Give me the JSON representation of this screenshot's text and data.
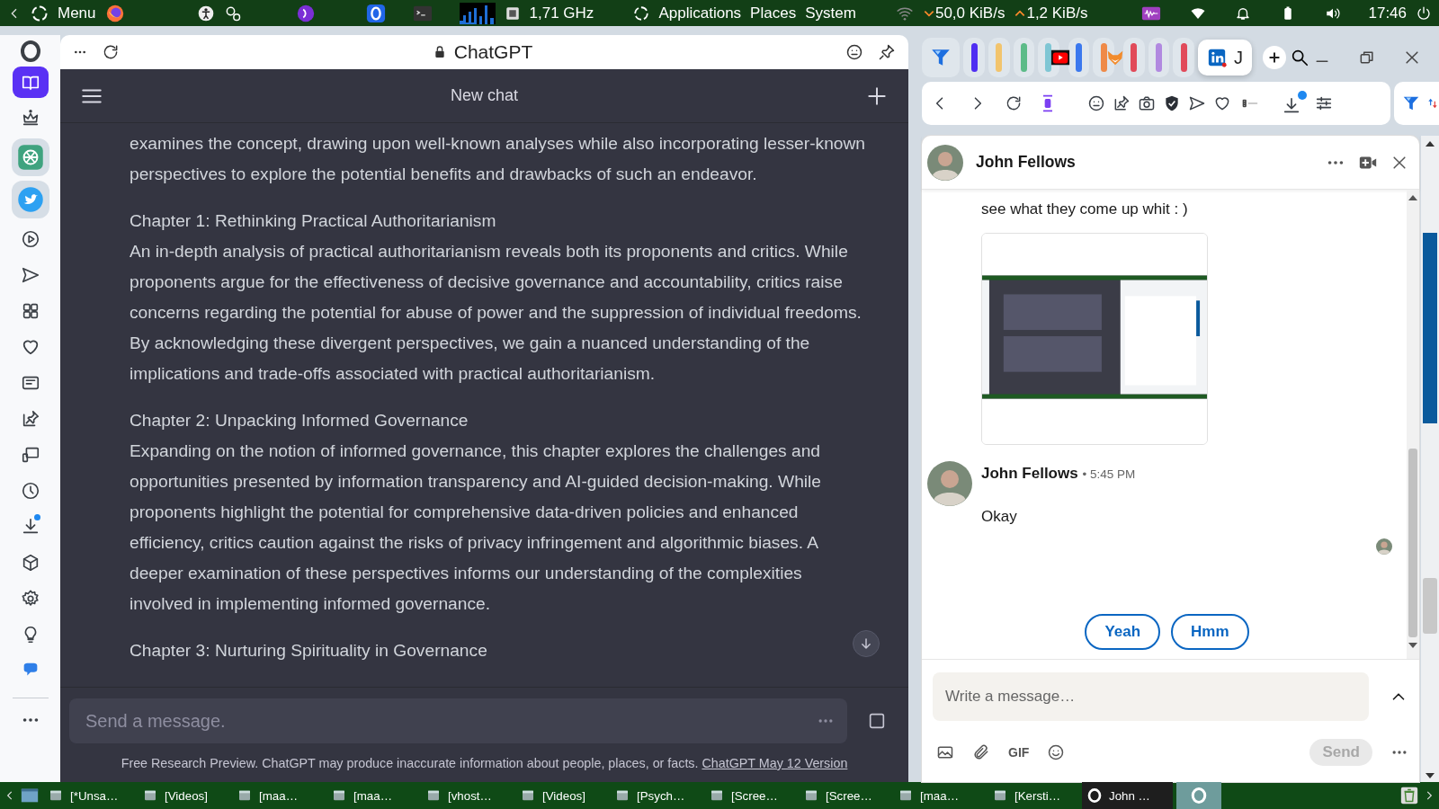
{
  "top_panel": {
    "menu_label": "Menu",
    "cpu_frequency": "1,71 GHz",
    "menus": [
      "Applications",
      "Places",
      "System"
    ],
    "download_rate": "50,0 KiB/s",
    "upload_rate": "1,2 KiB/s",
    "clock": "17:46"
  },
  "browser": {
    "sidebar_items": [
      {
        "selected": true
      },
      {
        "selected": false
      },
      {
        "selected": false
      },
      {
        "selected": false
      },
      {
        "selected": false
      },
      {
        "selected": false
      },
      {
        "selected": false
      },
      {
        "selected": false
      },
      {
        "selected": false
      },
      {
        "selected": false
      },
      {
        "selected": false
      },
      {
        "selected": false
      },
      {
        "selected": false
      },
      {
        "selected": false
      },
      {
        "selected": false
      },
      {
        "selected": false
      },
      {
        "selected": false
      }
    ],
    "address_bar": {
      "title": "ChatGPT"
    },
    "chatgpt": {
      "header_title": "New chat",
      "sections": [
        {
          "body": "examines the concept, drawing upon well-known analyses while also incorporating lesser-known perspectives to explore the potential benefits and drawbacks of such an endeavor."
        },
        {
          "heading": "Chapter 1: Rethinking Practical Authoritarianism",
          "body": "An in-depth analysis of practical authoritarianism reveals both its proponents and critics. While proponents argue for the effectiveness of decisive governance and accountability, critics raise concerns regarding the potential for abuse of power and the suppression of individual freedoms. By acknowledging these divergent perspectives, we gain a nuanced understanding of the implications and trade-offs associated with practical authoritarianism."
        },
        {
          "heading": "Chapter 2: Unpacking Informed Governance",
          "body": "Expanding on the notion of informed governance, this chapter explores the challenges and opportunities presented by information transparency and AI-guided decision-making. While proponents highlight the potential for comprehensive data-driven policies and enhanced efficiency, critics caution against the risks of privacy infringement and algorithmic biases. A deeper examination of these perspectives informs our understanding of the complexities involved in implementing informed governance."
        },
        {
          "heading": "Chapter 3: Nurturing Spirituality in Governance"
        }
      ],
      "input": {
        "placeholder": "Send a message."
      },
      "disclaimer": "Free Research Preview. ChatGPT may produce inaccurate information about people, places, or facts.",
      "version_link": "ChatGPT May 12 Version"
    },
    "tabs": [
      {
        "kind": "pill",
        "color": "#4f2ef2",
        "selected": false
      },
      {
        "kind": "pill",
        "color": "#f2c46d",
        "selected": false
      },
      {
        "kind": "pill",
        "color": "#5cbb88",
        "selected": false
      },
      {
        "kind": "pill",
        "color": "#7fc6d4",
        "selected": false
      },
      {
        "kind": "pill",
        "color": "#3b78ee",
        "selected": false
      },
      {
        "kind": "pill",
        "color": "#ef8a48",
        "selected": false
      },
      {
        "kind": "pill",
        "color": "#e14a59",
        "selected": false
      },
      {
        "kind": "pill",
        "color": "#b189e0",
        "selected": false
      },
      {
        "kind": "pill",
        "color": "#e14a5a",
        "selected": false
      },
      {
        "kind": "labeled",
        "label": "J",
        "selected": true
      }
    ],
    "messaging": {
      "contact_name": "John Fellows",
      "messages": [
        {
          "kind": "text",
          "text": "see what they come up whit : )"
        },
        {
          "kind": "picture"
        },
        {
          "kind": "header",
          "sender": "John Fellows",
          "time": "• 5:45 PM"
        },
        {
          "kind": "text",
          "text": "Okay"
        }
      ],
      "quick_replies": [
        "Yeah",
        "Hmm"
      ],
      "compose": {
        "placeholder": "Write a message…"
      },
      "gif_label": "GIF",
      "send_button": {
        "label": "Send",
        "disabled": true
      }
    }
  },
  "taskbar": {
    "items": [
      {
        "label": "[*Unsa…",
        "selected": false
      },
      {
        "label": "[Videos]",
        "selected": false
      },
      {
        "label": "[maa…",
        "selected": false
      },
      {
        "label": "[maa…",
        "selected": false
      },
      {
        "label": "[vhost…",
        "selected": false
      },
      {
        "label": "[Videos]",
        "selected": false
      },
      {
        "label": "[Psych…",
        "selected": false
      },
      {
        "label": "[Scree…",
        "selected": false
      },
      {
        "label": "[Scree…",
        "selected": false
      },
      {
        "label": "[maa…",
        "selected": false
      },
      {
        "label": "[Kersti…",
        "selected": false
      },
      {
        "label": "John …",
        "selected": true
      }
    ]
  }
}
